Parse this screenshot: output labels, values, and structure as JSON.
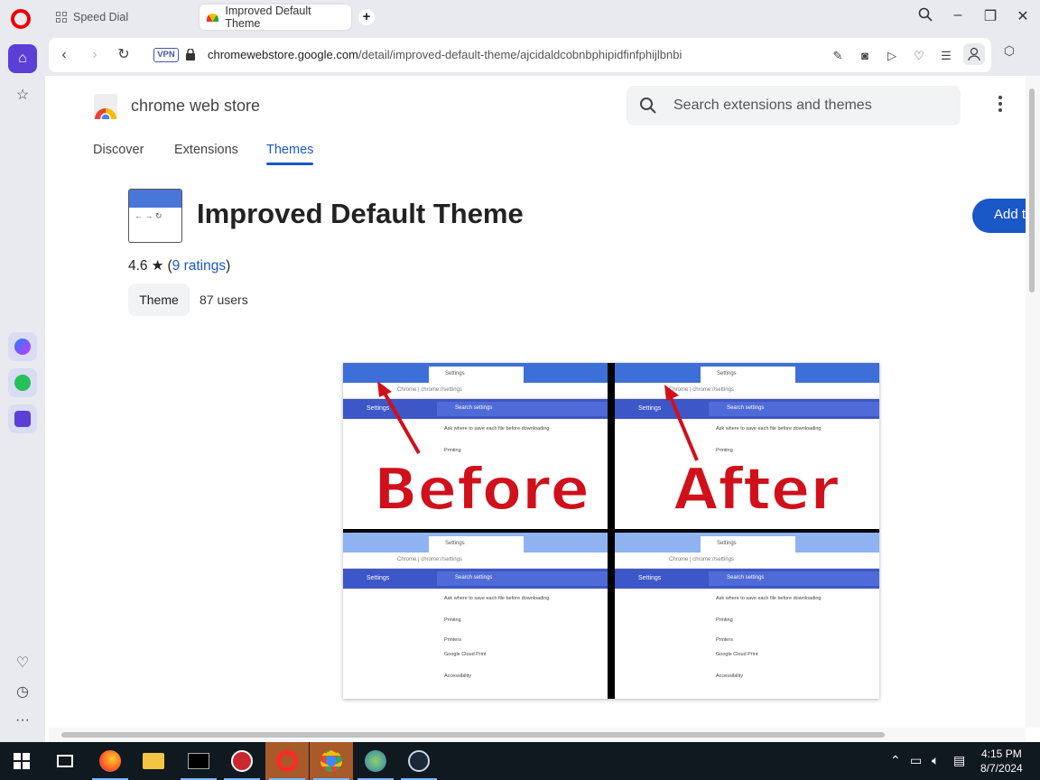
{
  "tabs": {
    "speed_dial": "Speed Dial",
    "active": "Improved Default Theme"
  },
  "address_bar": {
    "vpn": "VPN",
    "url_domain": "chromewebstore.google.com",
    "url_path": "/detail/improved-default-theme/ajcidaldcobnbphipidfinfphijlbnbi"
  },
  "store": {
    "name": "chrome web store",
    "search_placeholder": "Search extensions and themes",
    "nav": [
      "Discover",
      "Extensions",
      "Themes"
    ],
    "active_nav": "Themes"
  },
  "extension": {
    "title": "Improved Default Theme",
    "add_button": "Add t",
    "rating": "4.6",
    "rating_open": "(",
    "rating_link": "9 ratings",
    "rating_close": ")",
    "category": "Theme",
    "users": "87 users"
  },
  "screenshot": {
    "before_label": "Before",
    "after_label": "After",
    "tab_label": "Settings",
    "url_text": "Chrome  |  chrome://settings",
    "settings_label": "Settings",
    "search_label": "Search settings",
    "row_download": "Ask where to save each file before downloading",
    "row_printing": "Printing",
    "row_printers": "Printers",
    "row_cloud": "Google Cloud Print",
    "row_accessibility": "Accessibility"
  },
  "taskbar": {
    "time": "4:15 PM",
    "date": "8/7/2024"
  },
  "colors": {
    "accent": "#1a57c7",
    "opera_red": "#e00000",
    "sidebar_home": "#5b3fd6"
  }
}
